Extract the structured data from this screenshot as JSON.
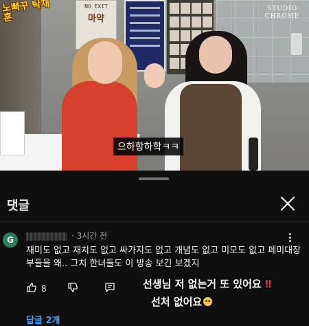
{
  "video": {
    "show_logo": "노빠꾸 탁재훈",
    "studio_logo_line1": "STUDIO",
    "studio_logo_line2": "CHROME",
    "notice_top": "NO EXIT",
    "notice_big": "마약",
    "subtitle": "으하항하학ㅋㅋ"
  },
  "comments_panel": {
    "title": "댓글",
    "close_icon": "close-icon"
  },
  "comment": {
    "avatar_letter": "G",
    "avatar_color": "#2e7d5b",
    "time": "· 3시간 전",
    "text": "재미도 없고 재치도 없고 싸가지도 없고 개념도 없고 미모도 없고 페미대장부들을 왜.. 그치 한녀들도 이 방송 보긴 보겠지",
    "like_count": "8",
    "replies": "답글 2개",
    "icons": [
      "like-icon",
      "dislike-icon",
      "reply-icon",
      "more-vert-icon"
    ]
  },
  "overlay": {
    "line1": "선생님 저 없는거 또 있어요",
    "line1_emoji": "‼",
    "line2": "선처 없어요"
  },
  "colors": {
    "background": "#0f0f0f",
    "link": "#3ea6ff",
    "meta_text": "#aaaaaa"
  }
}
